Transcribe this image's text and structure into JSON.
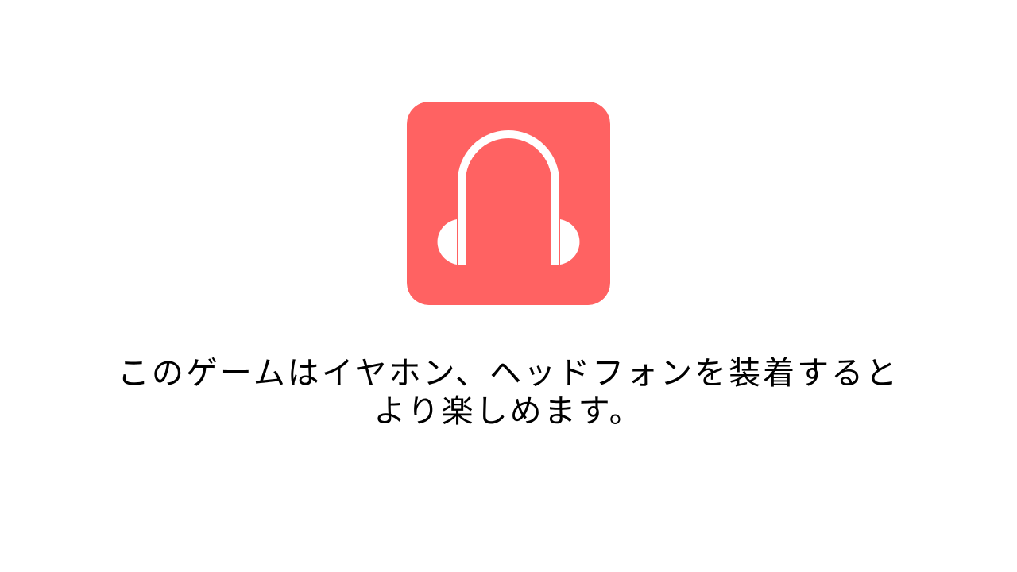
{
  "notice": {
    "icon": "headphones-icon",
    "icon_bg_color": "#FF6262",
    "icon_fg_color": "#FFFFFF",
    "text_color": "#000000",
    "background_color": "#FFFFFF",
    "message_lines": [
      "このゲームはイヤホン、ヘッドフォンを装着すると",
      "より楽しめます。"
    ]
  }
}
